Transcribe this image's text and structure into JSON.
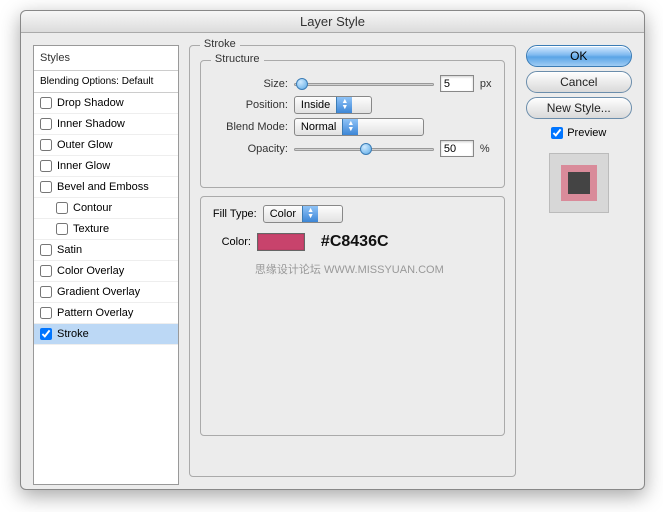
{
  "title": "Layer Style",
  "sidebar": {
    "header": "Styles",
    "blending": "Blending Options: Default",
    "items": [
      {
        "label": "Drop Shadow",
        "checked": false
      },
      {
        "label": "Inner Shadow",
        "checked": false
      },
      {
        "label": "Outer Glow",
        "checked": false
      },
      {
        "label": "Inner Glow",
        "checked": false
      },
      {
        "label": "Bevel and Emboss",
        "checked": false
      },
      {
        "label": "Contour",
        "checked": false,
        "sub": true
      },
      {
        "label": "Texture",
        "checked": false,
        "sub": true
      },
      {
        "label": "Satin",
        "checked": false
      },
      {
        "label": "Color Overlay",
        "checked": false
      },
      {
        "label": "Gradient Overlay",
        "checked": false
      },
      {
        "label": "Pattern Overlay",
        "checked": false
      },
      {
        "label": "Stroke",
        "checked": true,
        "selected": true
      }
    ]
  },
  "stroke": {
    "group_label": "Stroke",
    "structure_label": "Structure",
    "size_label": "Size:",
    "size_value": "5",
    "size_unit": "px",
    "position_label": "Position:",
    "position_value": "Inside",
    "blend_label": "Blend Mode:",
    "blend_value": "Normal",
    "opacity_label": "Opacity:",
    "opacity_value": "50",
    "opacity_unit": "%",
    "filltype_label": "Fill Type:",
    "filltype_value": "Color",
    "color_label": "Color:",
    "color_hex": "#C8436C",
    "color_swatch": "#c8436c"
  },
  "watermark": "思缘设计论坛  WWW.MISSYUAN.COM",
  "buttons": {
    "ok": "OK",
    "cancel": "Cancel",
    "newstyle": "New Style..."
  },
  "preview": {
    "label": "Preview",
    "checked": true
  }
}
